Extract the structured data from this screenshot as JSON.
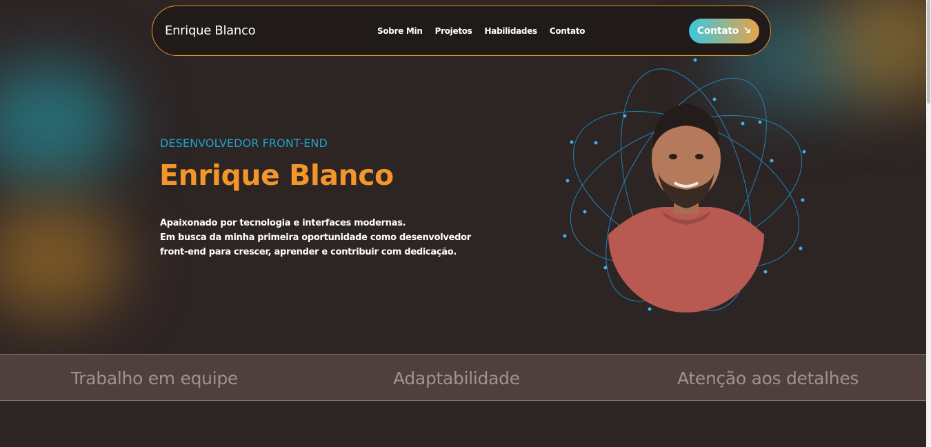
{
  "nav": {
    "brand": "Enrique Blanco",
    "links": [
      "Sobre Min",
      "Projetos",
      "Habilidades",
      "Contato"
    ],
    "cta_label": "Contato",
    "cta_icon": "arrow-down-right-icon"
  },
  "hero": {
    "subtitle": "DESENVOLVEDOR FRONT-END",
    "title": "Enrique Blanco",
    "description_lines": [
      "Apaixonado por tecnologia e interfaces modernas.",
      "Em busca da minha primeira oportunidade como desenvolvedor",
      "front-end para crescer, aprender e contribuir com dedicação."
    ]
  },
  "skills": [
    "Trabalho em equipe",
    "Adaptabilidade",
    "Atenção aos detalhes"
  ],
  "colors": {
    "background": "#2d2424",
    "accent_orange": "#f3962a",
    "accent_teal": "#1ea5c9",
    "skills_bar": "#4f3f3d"
  }
}
